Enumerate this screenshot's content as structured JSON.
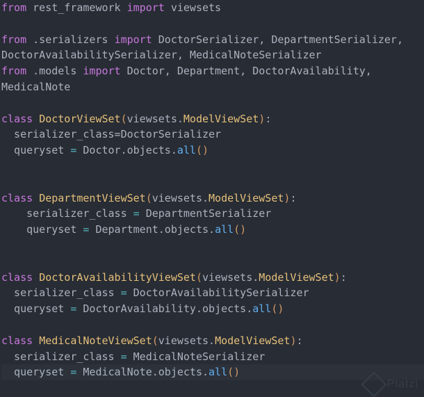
{
  "editor": {
    "lines": [
      [
        {
          "t": "from",
          "c": "kw"
        },
        {
          "t": " rest_framework ",
          "c": "plain"
        },
        {
          "t": "import",
          "c": "kw"
        },
        {
          "t": " viewsets",
          "c": "plain"
        }
      ],
      [],
      [
        {
          "t": "from",
          "c": "kw"
        },
        {
          "t": " .serializers ",
          "c": "plain"
        },
        {
          "t": "import",
          "c": "kw"
        },
        {
          "t": " DoctorSerializer, DepartmentSerializer,",
          "c": "plain"
        }
      ],
      [
        {
          "t": "DoctorAvailabilitySerializer, MedicalNoteSerializer",
          "c": "plain"
        }
      ],
      [
        {
          "t": "from",
          "c": "kw"
        },
        {
          "t": " .models ",
          "c": "plain"
        },
        {
          "t": "import",
          "c": "kw"
        },
        {
          "t": " Doctor, Department, DoctorAvailability,",
          "c": "plain"
        }
      ],
      [
        {
          "t": "MedicalNote",
          "c": "plain"
        }
      ],
      [],
      [
        {
          "t": "class",
          "c": "kw"
        },
        {
          "t": " ",
          "c": "plain"
        },
        {
          "t": "DoctorViewSet",
          "c": "cls"
        },
        {
          "t": "(",
          "c": "paren"
        },
        {
          "t": "viewsets.",
          "c": "plain"
        },
        {
          "t": "ModelViewSet",
          "c": "cls"
        },
        {
          "t": ")",
          "c": "paren"
        },
        {
          "t": ":",
          "c": "plain"
        }
      ],
      [
        {
          "t": "  serializer_class=DoctorSerializer",
          "c": "plain"
        }
      ],
      [
        {
          "t": "  queryset ",
          "c": "plain"
        },
        {
          "t": "=",
          "c": "op"
        },
        {
          "t": " Doctor.objects.",
          "c": "plain"
        },
        {
          "t": "all",
          "c": "fn"
        },
        {
          "t": "()",
          "c": "paren"
        }
      ],
      [],
      [],
      [
        {
          "t": "class",
          "c": "kw"
        },
        {
          "t": " ",
          "c": "plain"
        },
        {
          "t": "DepartmentViewSet",
          "c": "cls"
        },
        {
          "t": "(",
          "c": "paren"
        },
        {
          "t": "viewsets.",
          "c": "plain"
        },
        {
          "t": "ModelViewSet",
          "c": "cls"
        },
        {
          "t": ")",
          "c": "paren"
        },
        {
          "t": ":",
          "c": "plain"
        }
      ],
      [
        {
          "t": "    serializer_class ",
          "c": "plain"
        },
        {
          "t": "=",
          "c": "op"
        },
        {
          "t": " DepartmentSerializer",
          "c": "plain"
        }
      ],
      [
        {
          "t": "    queryset ",
          "c": "plain"
        },
        {
          "t": "=",
          "c": "op"
        },
        {
          "t": " Department.objects.",
          "c": "plain"
        },
        {
          "t": "all",
          "c": "fn"
        },
        {
          "t": "()",
          "c": "paren"
        }
      ],
      [],
      [],
      [
        {
          "t": "class",
          "c": "kw"
        },
        {
          "t": " ",
          "c": "plain"
        },
        {
          "t": "DoctorAvailabilityViewSet",
          "c": "cls"
        },
        {
          "t": "(",
          "c": "paren"
        },
        {
          "t": "viewsets.",
          "c": "plain"
        },
        {
          "t": "ModelViewSet",
          "c": "cls"
        },
        {
          "t": ")",
          "c": "paren"
        },
        {
          "t": ":",
          "c": "plain"
        }
      ],
      [
        {
          "t": "  serializer_class ",
          "c": "plain"
        },
        {
          "t": "=",
          "c": "op"
        },
        {
          "t": " DoctorAvailabilitySerializer",
          "c": "plain"
        }
      ],
      [
        {
          "t": "  queryset ",
          "c": "plain"
        },
        {
          "t": "=",
          "c": "op"
        },
        {
          "t": " DoctorAvailability.objects.",
          "c": "plain"
        },
        {
          "t": "all",
          "c": "fn"
        },
        {
          "t": "()",
          "c": "paren"
        }
      ],
      [],
      [
        {
          "t": "class",
          "c": "kw"
        },
        {
          "t": " ",
          "c": "plain"
        },
        {
          "t": "MedicalNoteViewSet",
          "c": "cls"
        },
        {
          "t": "(",
          "c": "paren"
        },
        {
          "t": "viewsets.",
          "c": "plain"
        },
        {
          "t": "ModelViewSet",
          "c": "cls"
        },
        {
          "t": ")",
          "c": "paren"
        },
        {
          "t": ":",
          "c": "plain"
        }
      ],
      [
        {
          "t": "  serializer_class ",
          "c": "plain"
        },
        {
          "t": "=",
          "c": "op"
        },
        {
          "t": " MedicalNoteSerializer",
          "c": "plain"
        }
      ],
      [
        {
          "t": "  queryset ",
          "c": "plain"
        },
        {
          "t": "=",
          "c": "op"
        },
        {
          "t": " MedicalNote.objects.",
          "c": "plain"
        },
        {
          "t": "all",
          "c": "fn"
        },
        {
          "t": "()",
          "c": "paren"
        }
      ]
    ],
    "current_line": 23
  },
  "watermark": {
    "text": "Platzi"
  },
  "colors": {
    "background": "#282c34",
    "keyword": "#c678dd",
    "class_name": "#e5c07b",
    "function": "#61afef",
    "paren": "#d19a66",
    "operator": "#56b6c2",
    "text": "#abb2bf"
  }
}
